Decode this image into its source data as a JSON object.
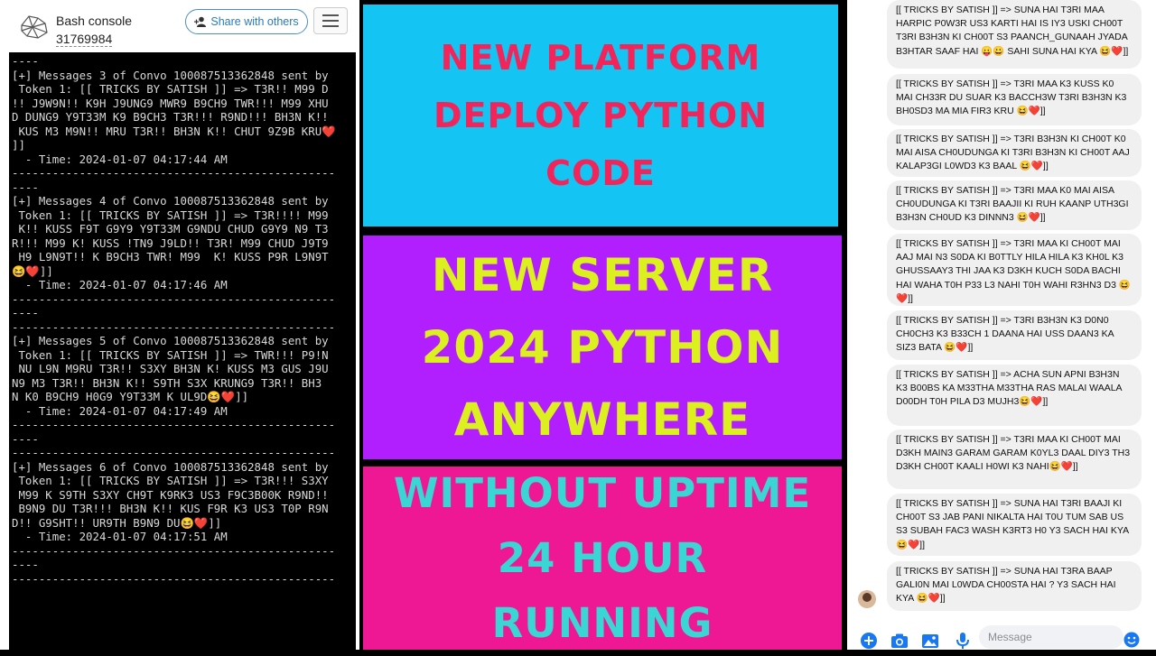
{
  "console": {
    "title": "Bash console",
    "id": "31769984",
    "share_label": "Share with others",
    "lines": [
      "----",
      "[+] Messages 3 of Convo 100087513362848 sent by",
      " Token 1: [[ TRICKS BY SATISH ]] => T3R!! M99 D",
      "!! J9W9N!! K9H J9UNG9 MWR9 B9CH9 TWR!!! M99 XHU",
      "D DUNG9 Y9T33M K9 B9CH3 T3R!!! R9ND!!! BH3N K!!",
      " KUS M3 M9N!! MRU T3R!! BH3N K!! CHUT 9Z9B KRU❤️",
      "]]",
      "  - Time: 2024-01-07 04:17:44 AM",
      "------------------------------------------------",
      "----",
      "[+] Messages 4 of Convo 100087513362848 sent by",
      " Token 1: [[ TRICKS BY SATISH ]] => T3R!!!! M99",
      " K!! KUSS F9T G9Y9 Y9T33M G9NDU CHUD G9Y9 N9 T3",
      "R!!! M99 K! KUSS !TN9 J9LD!! T3R! M99 CHUD J9T9",
      " H9 L9N9T!! K B9CH3 TWR! M99  K! KUSS P9R L9N9T",
      "😆❤️]]",
      "  - Time: 2024-01-07 04:17:46 AM",
      "------------------------------------------------",
      "----",
      "------------------------------------------------",
      "[+] Messages 5 of Convo 100087513362848 sent by",
      " Token 1: [[ TRICKS BY SATISH ]] => TWR!!! P9!N",
      " NU L9N M9RU T3R!! S3XY BH3N K! KUSS M3 GUS J9U",
      "N9 M3 T3R!! BH3N K!! S9TH S3X KRUNG9 T3R!! BH3",
      "N K0 B9CH9 H0G9 Y9T33M K UL9D😆❤️]]",
      "  - Time: 2024-01-07 04:17:49 AM",
      "------------------------------------------------",
      "----",
      "------------------------------------------------",
      "[+] Messages 6 of Convo 100087513362848 sent by",
      " Token 1: [[ TRICKS BY SATISH ]] => T3R!!! S3XY",
      " M99 K S9TH S3XY CH9T K9RK3 US3 F9C3B00K R9ND!!",
      " B9N9 DU T3R!!! BH3N K!! KUS F9R K3 US3 T0P R9N",
      "D!! G9SHT!! UR9TH B9N9 DU😆❤️]]",
      "  - Time: 2024-01-07 04:17:51 AM",
      "------------------------------------------------",
      "----",
      "------------------------------------------------"
    ]
  },
  "banners": [
    {
      "lines": [
        "NEW PLATFORM",
        "DEPLOY PYTHON",
        "CODE"
      ],
      "bg": "#14c4f2",
      "color": "#f2245a"
    },
    {
      "lines": [
        "NEW SERVER",
        "2024 PYTHON",
        "ANYWHERE"
      ],
      "bg": "#b11fff",
      "color": "#dcf020"
    },
    {
      "lines": [
        "WITHOUT UPTIME",
        "24 HOUR",
        "RUNNING"
      ],
      "bg": "#ee1894",
      "color": "#3ad6d6"
    }
  ],
  "chat": {
    "messages": [
      "[[ TRICKS BY SATISH ]] => SUNA HAI T3RI MAA HARPIC P0W3R US3 KARTI HAI IS IY3 USKI CH00T T3RI B3H3N KI CH00T S3 PAANCH_GUNAAH JYADA B3HTAR SAAF HAI 😛😀 SAHI SUNA HAI KYA 😆❤️]]",
      "[[ TRICKS BY SATISH ]] => T3RI MAA K3 KUSS K0 MAI CH33R DU SUAR K3 BACCH3W T3RI B3H3N K3 BH0SD3 MA MIA FIR3 KRU 😆❤️]]",
      "[[ TRICKS BY SATISH ]] => T3RI B3H3N KI CH00T K0 MAI AISA CH0UDUNGA KI T3RI B3H3N KI CH00T AAJ KALAP3GI L0WD3 K3 BAAL 😆❤️]]",
      "[[ TRICKS BY SATISH ]] => T3RI MAA K0 MAI AISA CH0UDUNGA KI T3RI BAAJII KI RUH KAANP UTH3GI B3H3N CH0UD K3 DINNN3 😆❤️]]",
      "[[ TRICKS BY SATISH ]] => T3RI MAA KI CH00T MAI AAJ MAI N3 S0DA KI B0TTLY HILA HILA K3 KH0L K3 GHUSSAAY3 THI JAA K3 D3KH KUCH S0DA BACHI HAI WAHA T0H P33 L3 NAHI T0H WAHI R3HN3 D3 😆❤️]]",
      "[[ TRICKS BY SATISH ]] => T3RI B3H3N K3 D0N0 CH0CH3 K3 B33CH 1 DAANA HAI USS DAAN3 KA SIZ3 BATA 😆❤️]]",
      "[[ TRICKS BY SATISH ]] => ACHA SUN APNI B3H3N K3 B00BS KA M33THA M33THA RAS MALAI WAALA D00DH T0H PILA D3 MUJH3😆❤️]]",
      "[[ TRICKS BY SATISH ]] => T3RI MAA KI CH00T MAI D3KH MAIN3 GARAM GARAM K0YL3 DAAL DIY3 TH3 D3KH CH00T KAALI H0WI K3 NAHI😆❤️]]",
      "[[ TRICKS BY SATISH ]] => SUNA HAI T3RI BAAJI KI CH00T S3 JAB PANI NIKALTA HAI T0U TUM SAB US S3 SUBAH FAC3 WASH K3RT3 H0 Y3 SACH HAI KYA😆❤️]]",
      "[[ TRICKS BY SATISH ]] => SUNA HAI T3RA BAAP GALI0N MAI L0WDA CH00STA HAI ? Y3 SACH HAI KYA 😆❤️]]"
    ],
    "placeholder": "Message"
  }
}
